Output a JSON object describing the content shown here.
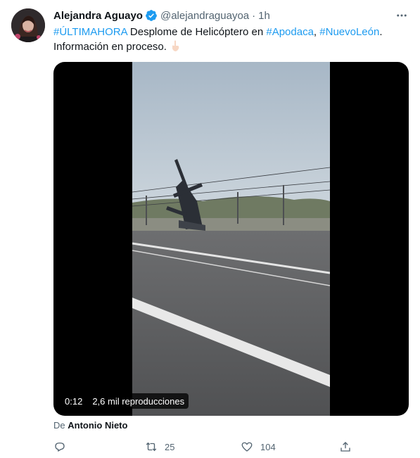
{
  "tweet": {
    "author": {
      "display_name": "Alejandra Aguayo",
      "handle": "@alejandraguayoa",
      "verified": true,
      "avatar_icon": "profile-photo"
    },
    "separator": "·",
    "time": "1h",
    "text": {
      "hashtag_1": "#ÚLTIMAHORA",
      "part_1": " Desplome de Helicóptero en ",
      "hashtag_2": "#Apodaca",
      "part_2": ", ",
      "hashtag_3": "#NuevoLeón",
      "part_3": ".",
      "line_2": "Información en proceso. ",
      "emoji": "pointing-down-emoji"
    },
    "media": {
      "duration": "0:12",
      "views": "2,6 mil reproducciones"
    },
    "attribution": {
      "prefix": "De ",
      "name": "Antonio Nieto"
    },
    "actions": {
      "reply_icon": "reply-icon",
      "retweet_count": "25",
      "like_count": "104",
      "share_icon": "share-icon"
    }
  },
  "colors": {
    "link": "#1d9bf0",
    "secondary_text": "#536471",
    "primary_text": "#0f1419",
    "verified": "#1d9bf0"
  }
}
